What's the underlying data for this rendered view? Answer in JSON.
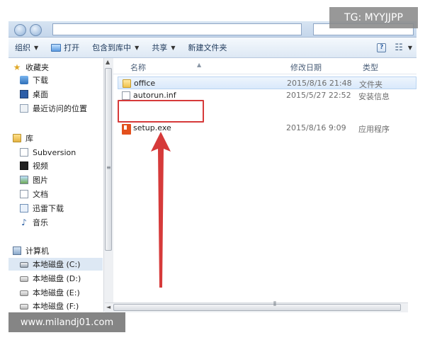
{
  "toolbar": {
    "organize": "组织",
    "open": "打开",
    "include_in_library": "包含到库中",
    "share": "共享",
    "new_folder": "新建文件夹"
  },
  "sidebar": {
    "favorites": "收藏夹",
    "downloads": "下载",
    "desktop": "桌面",
    "recent_places": "最近访问的位置",
    "libraries": "库",
    "subversion": "Subversion",
    "videos": "视频",
    "pictures": "图片",
    "documents": "文档",
    "thunder_downloads": "迅雷下载",
    "music": "音乐",
    "computer": "计算机",
    "drive_c": "本地磁盘 (C:)",
    "drive_d": "本地磁盘 (D:)",
    "drive_e": "本地磁盘 (E:)",
    "drive_f": "本地磁盘 (F:)"
  },
  "columns": {
    "name": "名称",
    "date_modified": "修改日期",
    "type": "类型"
  },
  "files": [
    {
      "name": "office",
      "date": "2015/8/16 21:48",
      "type": "文件夹"
    },
    {
      "name": "autorun.inf",
      "date": "2015/5/27 22:52",
      "type": "安装信息"
    },
    {
      "name": "setup.exe",
      "date": "2015/8/16 9:09",
      "type": "应用程序"
    }
  ],
  "watermarks": {
    "top": "TG: MYYJJPP",
    "bottom": "www.milandj01.com"
  },
  "colors": {
    "highlight": "#d63a3a",
    "selection": "#d9e9fb",
    "toolbar_text": "#1e395b"
  }
}
